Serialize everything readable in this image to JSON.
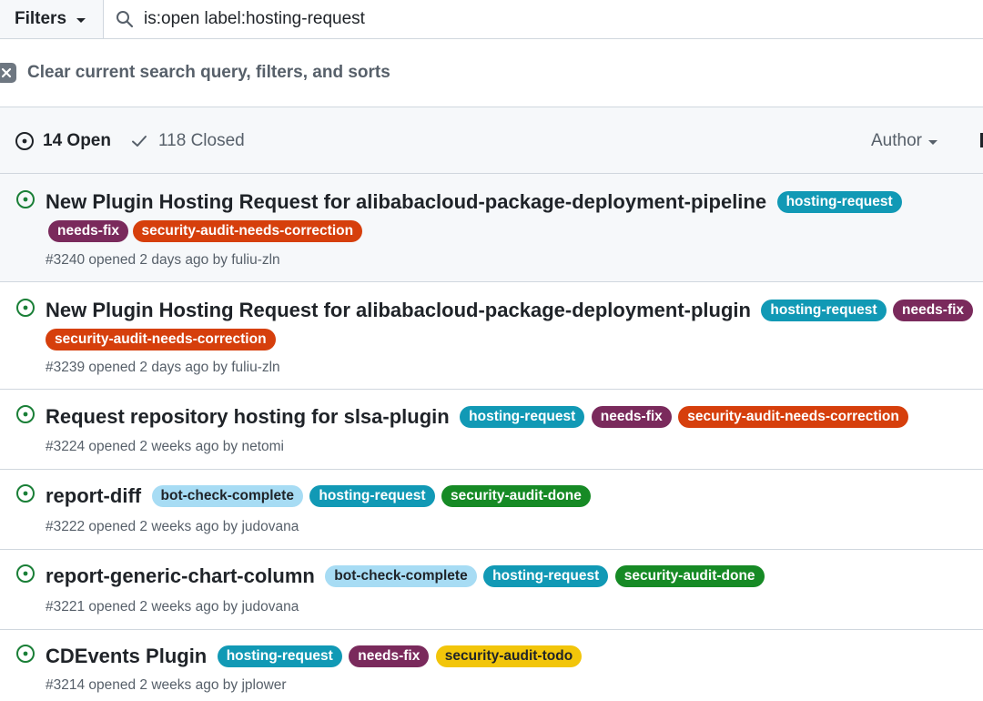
{
  "search": {
    "filters_label": "Filters",
    "query": "is:open label:hosting-request"
  },
  "clear": {
    "text": "Clear current search query, filters, and sorts"
  },
  "header": {
    "open_label": "14 Open",
    "closed_label": "118 Closed",
    "author_label": "Author"
  },
  "colors": {
    "open_icon": "#1a7f37",
    "hosting-request": "#1199b5",
    "needs-fix": "#7a2a5c",
    "security-audit-needs-correction": "#d63f0c",
    "bot-check-complete": "#a7dcf4",
    "security-audit-done": "#168a25",
    "security-audit-todo": "#f2c50a"
  },
  "issues": [
    {
      "title": "New Plugin Hosting Request for alibabacloud-package-deployment-pipeline",
      "labels": [
        "hosting-request",
        "needs-fix",
        "security-audit-needs-correction"
      ],
      "meta": "#3240 opened 2 days ago by fuliu-zln"
    },
    {
      "title": "New Plugin Hosting Request for alibabacloud-package-deployment-plugin",
      "labels": [
        "hosting-request",
        "needs-fix",
        "security-audit-needs-correction"
      ],
      "meta": "#3239 opened 2 days ago by fuliu-zln"
    },
    {
      "title": "Request repository hosting for slsa-plugin",
      "labels": [
        "hosting-request",
        "needs-fix",
        "security-audit-needs-correction"
      ],
      "meta": "#3224 opened 2 weeks ago by netomi"
    },
    {
      "title": "report-diff",
      "labels": [
        "bot-check-complete",
        "hosting-request",
        "security-audit-done"
      ],
      "meta": "#3222 opened 2 weeks ago by judovana"
    },
    {
      "title": "report-generic-chart-column",
      "labels": [
        "bot-check-complete",
        "hosting-request",
        "security-audit-done"
      ],
      "meta": "#3221 opened 2 weeks ago by judovana"
    },
    {
      "title": "CDEvents Plugin",
      "labels": [
        "hosting-request",
        "needs-fix",
        "security-audit-todo"
      ],
      "meta": "#3214 opened 2 weeks ago by jplower"
    }
  ]
}
